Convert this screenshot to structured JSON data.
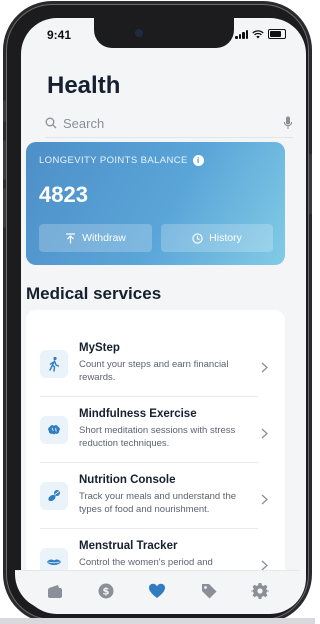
{
  "status_bar": {
    "time": "9:41"
  },
  "header": {
    "title": "Health"
  },
  "search": {
    "placeholder": "Search"
  },
  "points_card": {
    "label": "LONGEVITY POINTS BALANCE",
    "balance": "4823",
    "withdraw_label": "Withdraw",
    "history_label": "History"
  },
  "medical_services": {
    "heading": "Medical services",
    "items": [
      {
        "title": "MyStep",
        "description": "Count your steps and earn financial rewards.",
        "icon": "walking-person-icon"
      },
      {
        "title": "Mindfulness Exercise",
        "description": "Short meditation sessions with stress reduction techniques.",
        "icon": "brain-icon"
      },
      {
        "title": "Nutrition Console",
        "description": "Track your meals and understand the types of food and nourishment.",
        "icon": "pills-icon"
      },
      {
        "title": "Menstrual Tracker",
        "description": "Control the women's period and",
        "icon": "lips-icon"
      }
    ]
  },
  "tab_bar": {
    "tabs": [
      {
        "icon": "wallet-icon",
        "active": false
      },
      {
        "icon": "dollar-coin-icon",
        "active": false
      },
      {
        "icon": "heart-icon",
        "active": true
      },
      {
        "icon": "tag-icon",
        "active": false
      },
      {
        "icon": "gear-icon",
        "active": false
      }
    ]
  },
  "colors": {
    "accent": "#2f7dc0",
    "card_start": "#4d8fc7",
    "card_end": "#82cbe6",
    "tab_inactive": "#8b8f98"
  }
}
